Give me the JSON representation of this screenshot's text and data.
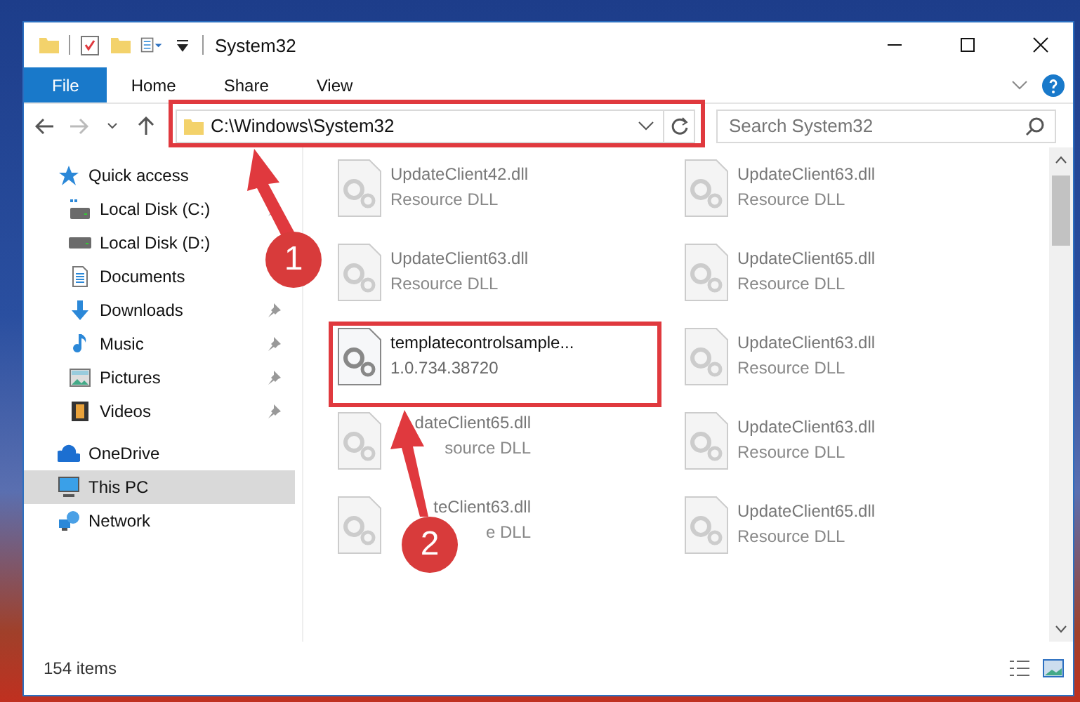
{
  "window": {
    "title": "System32"
  },
  "ribbon_tabs": [
    {
      "label": "File",
      "selected": true
    },
    {
      "label": "Home",
      "selected": false
    },
    {
      "label": "Share",
      "selected": false
    },
    {
      "label": "View",
      "selected": false
    }
  ],
  "address_bar": {
    "path": "C:\\Windows\\System32"
  },
  "search": {
    "placeholder": "Search System32"
  },
  "sidebar": {
    "items": [
      {
        "label": "Quick access",
        "kind": "star",
        "selected": false,
        "children": [
          {
            "label": "Local Disk (C:)",
            "kind": "system-disk",
            "pinned": true,
            "selected": false
          },
          {
            "label": "Local Disk (D:)",
            "kind": "disk",
            "pinned": false,
            "selected": false
          },
          {
            "label": "Documents",
            "kind": "document",
            "pinned": false,
            "selected": false
          },
          {
            "label": "Downloads",
            "kind": "download",
            "pinned": true,
            "selected": false
          },
          {
            "label": "Music",
            "kind": "music",
            "pinned": true,
            "selected": false
          },
          {
            "label": "Pictures",
            "kind": "pictures",
            "pinned": true,
            "selected": false
          },
          {
            "label": "Videos",
            "kind": "videos",
            "pinned": true,
            "selected": false
          }
        ]
      },
      {
        "label": "OneDrive",
        "kind": "cloud",
        "selected": false
      },
      {
        "label": "This PC",
        "kind": "computer",
        "selected": true
      },
      {
        "label": "Network",
        "kind": "network",
        "selected": false
      }
    ]
  },
  "files": [
    {
      "name": "UpdateClient42.dll",
      "detail": "Resource DLL",
      "kind": "faded"
    },
    {
      "name": "UpdateClient63.dll",
      "detail": "Resource DLL",
      "kind": "faded"
    },
    {
      "name": "UpdateClient63.dll",
      "detail": "Resource DLL",
      "kind": "faded"
    },
    {
      "name": "UpdateClient65.dll",
      "detail": "Resource DLL",
      "kind": "faded"
    },
    {
      "name": "templatecontrolsample...",
      "detail": "1.0.734.38720",
      "kind": "normal"
    },
    {
      "name": "UpdateClient63.dll",
      "detail": "Resource DLL",
      "kind": "faded"
    },
    {
      "name": "dateClient65.dll",
      "detail": "source DLL",
      "kind": "covered"
    },
    {
      "name": "UpdateClient63.dll",
      "detail": "Resource DLL",
      "kind": "faded"
    },
    {
      "name": "teClient63.dll",
      "detail": "e DLL",
      "kind": "covered"
    },
    {
      "name": "UpdateClient65.dll",
      "detail": "Resource DLL",
      "kind": "faded"
    }
  ],
  "status_bar": {
    "item_count": "154 items"
  },
  "annotations": [
    {
      "number": "1"
    },
    {
      "number": "2"
    }
  ]
}
